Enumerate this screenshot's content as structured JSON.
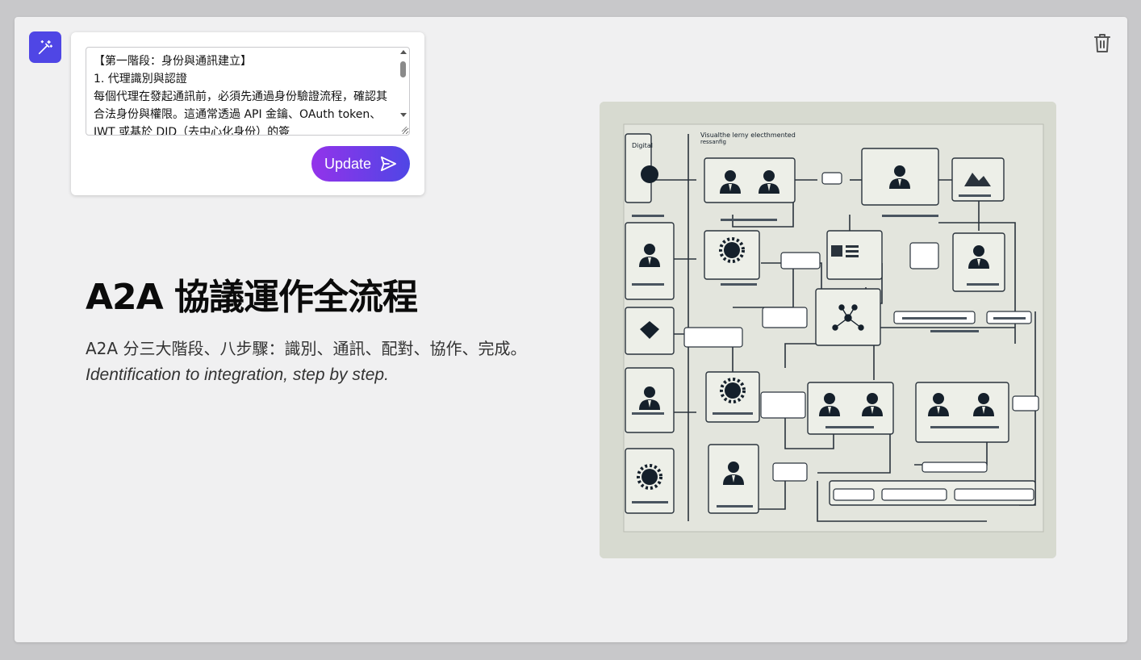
{
  "editor": {
    "text": "【第一階段：身份與通訊建立】\n1. 代理識別與認證\n每個代理在發起通訊前，必須先通過身份驗證流程，確認其合法身份與權限。這通常透過 API 金鑰、OAuth token、JWT 或基於 DID（去中心化身份）的簽",
    "update_label": "Update"
  },
  "slide": {
    "title": "A2A 協議運作全流程",
    "subtitle_cn": "A2A 分三大階段、八步驟：識別、通訊、配對、協作、完成。",
    "subtitle_en": "Identification to integration, step by step."
  },
  "illustration": {
    "label_top_left": "Digital ",
    "label_top": "Visualthe lerny electhmented",
    "label_top_2": "ressanfig",
    "icons": [
      "magic-wand-icon",
      "trash-icon",
      "send-icon"
    ]
  },
  "colors": {
    "accent": "#4f46e5",
    "gradient_start": "#9333ea",
    "gradient_end": "#4f46e5",
    "background": "#f0f0f1"
  }
}
